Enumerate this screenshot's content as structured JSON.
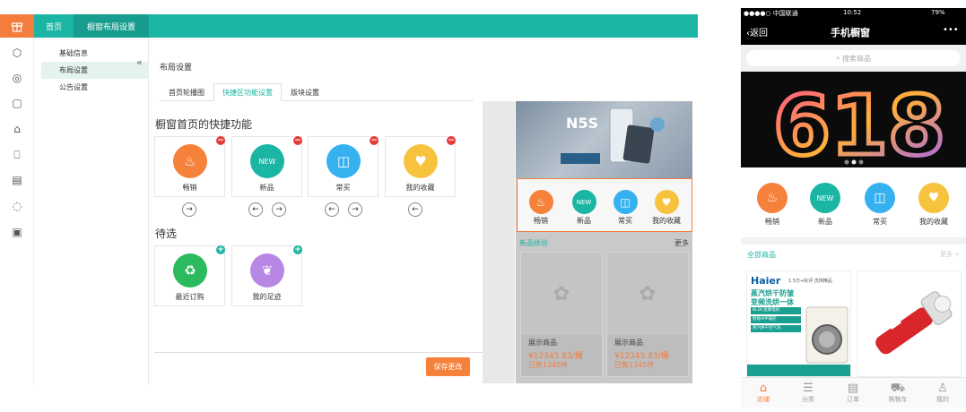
{
  "topnav": {
    "home": "首页",
    "active": "橱窗布局设置"
  },
  "rail_icons": [
    "box-icon",
    "compass-icon",
    "bag-icon",
    "cart-icon",
    "home-icon",
    "clipboard-icon",
    "document-icon",
    "spinner-icon",
    "note-icon"
  ],
  "submenu": {
    "items": [
      {
        "label": "基础信息"
      },
      {
        "label": "布局设置"
      },
      {
        "label": "公告设置"
      }
    ],
    "collapse": "«"
  },
  "main": {
    "title": "布局设置",
    "tabs": [
      {
        "label": "首页轮播图"
      },
      {
        "label": "快捷区功能设置"
      },
      {
        "label": "版块设置"
      }
    ],
    "quick_heading": "橱窗首页的快捷功能",
    "pending_heading": "待选",
    "quick": [
      {
        "label": "畅销",
        "color": "#f6813a",
        "icon": "flame-icon"
      },
      {
        "label": "新品",
        "color": "#1bb5a3",
        "icon": "new-tag-icon"
      },
      {
        "label": "常买",
        "color": "#36b1f0",
        "icon": "shopping-bag-icon"
      },
      {
        "label": "我的收藏",
        "color": "#f7c23e",
        "icon": "heart-icon"
      }
    ],
    "pending": [
      {
        "label": "最近订购",
        "color": "#2bbb5e",
        "icon": "recent-order-icon"
      },
      {
        "label": "我的足迹",
        "color": "#b887e6",
        "icon": "footprint-icon"
      }
    ],
    "save": "保存更改"
  },
  "preview": {
    "quick": [
      "畅销",
      "新品",
      "常买",
      "我的收藏"
    ],
    "new_title": "新品体验",
    "more": "更多",
    "products": [
      {
        "name": "展示商品",
        "price": "¥12345.83/桶",
        "sold": "已售1345件"
      },
      {
        "name": "展示商品",
        "price": "¥12345.83/桶",
        "sold": "已售1345件"
      }
    ]
  },
  "phone": {
    "status": {
      "carrier": "●●●●○ 中国联通",
      "time": "10:52",
      "battery": "79%"
    },
    "back": "返回",
    "title": "手机橱窗",
    "more": "•••",
    "search_placeholder": "搜索商品",
    "banner_text": "618",
    "quick": [
      "畅销",
      "新品",
      "常买",
      "我的收藏"
    ],
    "all_products": "全部商品",
    "all_more": "更多 >",
    "haier": {
      "brand": "Haier",
      "tag": "1.5万+好评 洗烘精品",
      "lines": [
        "蒸汽烘干防皱",
        "变频洗烘一体"
      ],
      "features": [
        "BLDC变频电机",
        "智能APP操控",
        "蒸汽烘干空气洗"
      ]
    },
    "tabs": [
      {
        "label": "店铺",
        "icon": "store-icon"
      },
      {
        "label": "分类",
        "icon": "category-icon"
      },
      {
        "label": "订单",
        "icon": "order-icon"
      },
      {
        "label": "购物车",
        "icon": "cart-icon"
      },
      {
        "label": "我的",
        "icon": "user-icon"
      }
    ]
  }
}
